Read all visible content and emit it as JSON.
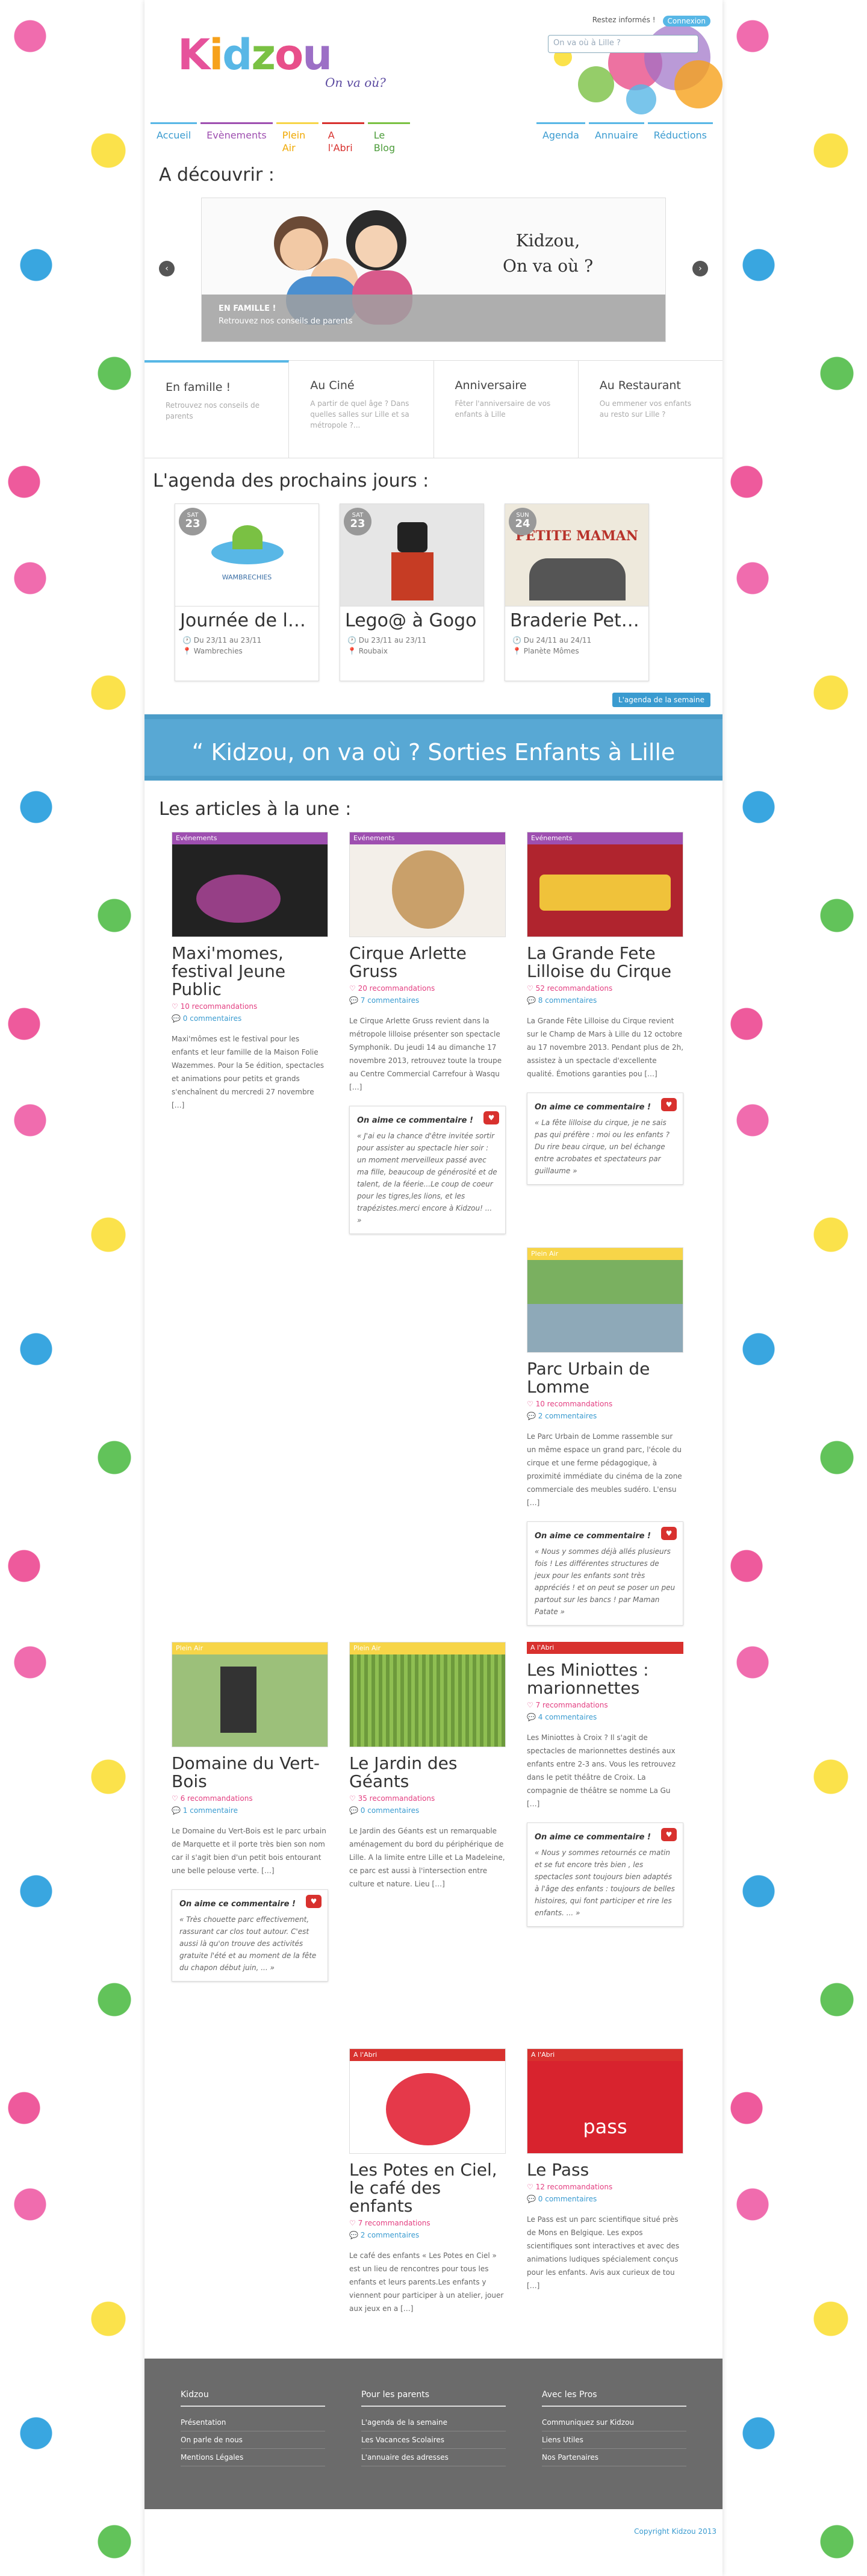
{
  "header": {
    "logo": "Kidzou",
    "logo_tagline": "On va où?",
    "toplinks": [
      "Restez informés !",
      "Connexion"
    ],
    "search_placeholder": "On va où à Lille ?"
  },
  "nav": [
    "Accueil",
    "Evènements",
    "Plein Air",
    "A l'Abri",
    "Le Blog",
    "Agenda",
    "Annuaire",
    "Réductions"
  ],
  "discover": {
    "title": "A découvrir :",
    "slide_title": "Kidzou,",
    "slide_subtitle": "On va où ?",
    "caption_title": "EN FAMILLE !",
    "caption_text": "Retrouvez nos conseils de parents"
  },
  "tabs": [
    {
      "title": "En famille !",
      "desc": "Retrouvez nos conseils de parents"
    },
    {
      "title": "Au Ciné",
      "desc": "A partir de quel âge ? Dans quelles salles sur Lille et sa métropole ?..."
    },
    {
      "title": "Anniversaire",
      "desc": "Fêter l'anniversaire de vos enfants à Lille"
    },
    {
      "title": "Au Restaurant",
      "desc": "Ou emmener vos enfants au resto sur Lille ?"
    }
  ],
  "agenda": {
    "title": "L'agenda des prochains jours :",
    "button": "L'agenda de la semaine",
    "events": [
      {
        "day": "SAT",
        "num": "23",
        "title": "Journée de la ...",
        "date": "Du 23/11 au 23/11",
        "place": "Wambrechies",
        "img_label": "WAMBRECHIES"
      },
      {
        "day": "SAT",
        "num": "23",
        "title": "Lego@ à Gogo",
        "date": "Du 23/11 au 23/11",
        "place": "Roubaix",
        "img_label": ""
      },
      {
        "day": "SUN",
        "num": "24",
        "title": "Braderie Petite...",
        "date": "Du 24/11 au 24/11",
        "place": "Planète Mômes",
        "img_label": "PETITE MAMAN"
      }
    ]
  },
  "banner": "“ Kidzou, on va où ? Sorties Enfants à Lille",
  "articles_title": "Les articles à la une :",
  "quote_title": "On aime ce commentaire !",
  "articles": [
    {
      "cat": "Evénements",
      "title": "Maxi'momes, festival Jeune Public",
      "rec": "10 recommandations",
      "com": "0 commentaires",
      "excerpt": "Maxi'mômes est le festival pour les enfants et leur famille de la Maison Folie Wazemmes. Pour la 5e édition, spectacles et animations pour petits et grands s'enchaînent du mercredi 27 novembre […]",
      "quote": ""
    },
    {
      "cat": "Evénements",
      "title": "Cirque Arlette Gruss",
      "rec": "20 recommandations",
      "com": "7 commentaires",
      "excerpt": "Le Cirque Arlette Gruss revient dans la métropole lilloise présenter son spectacle Symphonik. Du jeudi 14 au dimanche 17 novembre 2013, retrouvez toute la troupe au Centre Commercial Carrefour à Wasqu […]",
      "quote": "« J'ai eu la chance d'être invitée sortir pour assister au spectacle hier soir : un moment merveilleux passé avec ma fille, beaucoup de générosité et de talent, de la féerie...Le coup de coeur pour les tigres,les lions, et les trapézistes.merci encore à Kidzou! ... »"
    },
    {
      "cat": "Evénements",
      "title": "La Grande Fete Lilloise du Cirque",
      "rec": "52 recommandations",
      "com": "8 commentaires",
      "excerpt": "La Grande Fête Lilloise du Cirque revient sur le Champ de Mars à Lille du 12 octobre au 17 novembre 2013. Pendant plus de 2h, assistez à un spectacle d'excellente qualité. Émotions garanties pou […]",
      "quote": "« La fête lilloise du cirque, je ne sais pas qui préfère : moi ou les enfants ? Du rire beau cirque, un bel échange entre acrobates et spectateurs par guillaume »"
    },
    {
      "cat": "Plein Air",
      "title": "Parc Urbain de Lomme",
      "rec": "10 recommandations",
      "com": "2 commentaires",
      "excerpt": "Le Parc Urbain de Lomme rassemble sur un même espace un grand parc, l'école du cirque et une ferme pédagogique, à proximité immédiate du cinéma de la zone commerciale des meubles sudéro. L'ensu […]",
      "quote": "« Nous y sommes déjà allés plusieurs fois ! Les différentes structures de jeux pour les enfants sont très appréciés ! et on peut se poser un peu partout sur les bancs ! par Maman Patate »"
    },
    {
      "cat": "Plein Air",
      "title": "Domaine du Vert-Bois",
      "rec": "6 recommandations",
      "com": "1 commentaire",
      "excerpt": "Le Domaine du Vert-Bois est le parc urbain de Marquette et il porte très bien son nom car il s'agit bien d'un petit bois entourant une belle pelouse verte. […]",
      "quote": "« Très chouette parc effectivement, rassurant car clos tout autour. C'est aussi là qu'on trouve des activités gratuite l'été et au moment de la fête du chapon début juin, ... »"
    },
    {
      "cat": "Plein Air",
      "title": "Le Jardin des Géants",
      "rec": "35 recommandations",
      "com": "0 commentaires",
      "excerpt": "Le Jardin des Géants est un remarquable aménagement du bord du périphérique de Lille. A la limite entre Lille et La Madeleine, ce parc est aussi à l'intersection entre culture et nature. Lieu […]",
      "quote": ""
    },
    {
      "cat": "A l'Abri",
      "title": "Les Miniottes : marionnettes",
      "rec": "7 recommandations",
      "com": "4 commentaires",
      "excerpt": "Les Miniottes à Croix ? Il s'agit de spectacles de marionnettes destinés aux enfants entre 2-3 ans. Vous les retrouvez dans le petit théâtre de Croix. La compagnie de théâtre se nomme La Gu […]",
      "quote": "« Nous y sommes retournés ce matin et se fut encore très bien , les spectacles sont toujours bien adaptés à l'âge des enfants : toujours de belles histoires, qui font participer et rire les enfants. ... »"
    },
    {
      "cat": "A l'Abri",
      "title": "Les Potes en Ciel, le café des enfants",
      "rec": "7 recommandations",
      "com": "2 commentaires",
      "excerpt": "Le café des enfants « Les Potes en Ciel » est un lieu de rencontres pour tous les enfants et leurs parents.Les enfants y viennent pour participer à un atelier, jouer aux jeux en a […]",
      "quote": ""
    },
    {
      "cat": "A l'Abri",
      "title": "Le Pass",
      "rec": "12 recommandations",
      "com": "0 commentaires",
      "excerpt": "Le Pass est un parc scientifique situé près de Mons en Belgique. Les expos scientifiques sont interactives et avec des animations ludiques spécialement conçus pour les enfants. Avis aux curieux de tou […]",
      "quote": "",
      "img_label": "pass"
    }
  ],
  "footer": [
    {
      "title": "Kidzou",
      "items": [
        "Présentation",
        "On parle de nous",
        "Mentions Légales"
      ]
    },
    {
      "title": "Pour les parents",
      "items": [
        "L'agenda de la semaine",
        "Les Vacances Scolaires",
        "L'annuaire des adresses"
      ]
    },
    {
      "title": "Avec les Pros",
      "items": [
        "Communiquez sur Kidzou",
        "Liens Utiles",
        "Nos Partenaires"
      ]
    }
  ],
  "copyright": "Copyright Kidzou 2013",
  "colors": {
    "blue": "#58b7e6",
    "purple": "#9e4fb0",
    "yellow": "#f7d548",
    "red": "#d8312e"
  }
}
